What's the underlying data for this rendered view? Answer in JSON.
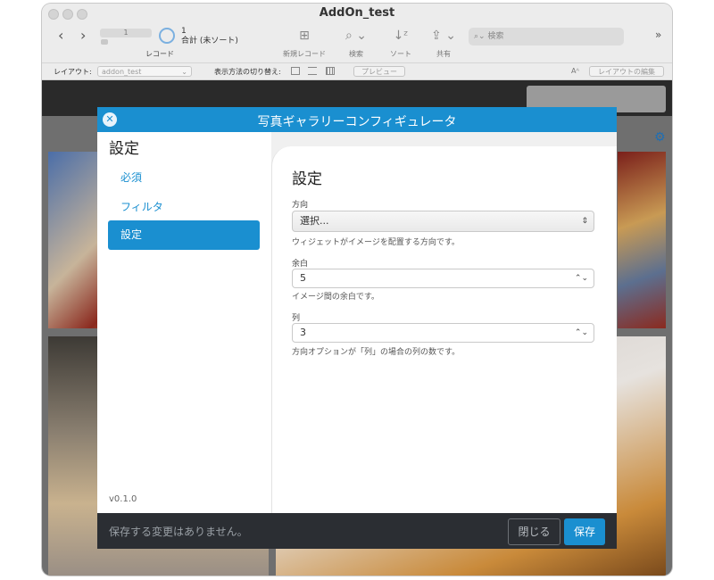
{
  "window": {
    "title": "AddOn_test"
  },
  "toolbar": {
    "record_slider_value": "1",
    "record_label": "レコード",
    "record_count": "1",
    "record_total": "合計 (未ソート)",
    "new_record": "新規レコード",
    "find": "検索",
    "sort": "ソート",
    "share": "共有",
    "search_placeholder": "検索",
    "overflow": "»"
  },
  "layoutbar": {
    "layout_label": "レイアウト:",
    "layout_value": "addon_test",
    "view_as_label": "表示方法の切り替え:",
    "preview": "プレビュー",
    "font_icon": "Aᴬ",
    "edit_layout": "レイアウトの編集"
  },
  "modal": {
    "title": "写真ギャラリーコンフィギュレータ",
    "close_glyph": "✕",
    "sidebar": {
      "title": "設定",
      "items": [
        "必須",
        "フィルタ",
        "設定"
      ],
      "active_index": 2,
      "version": "v0.1.0"
    },
    "main": {
      "title": "設定",
      "fields": [
        {
          "label": "方向",
          "value": "選択...",
          "help": "ウィジェットがイメージを配置する方向です。"
        },
        {
          "label": "余白",
          "value": "5",
          "help": "イメージ間の余白です。"
        },
        {
          "label": "列",
          "value": "3",
          "help": "方向オプションが「列」の場合の列の数です。"
        }
      ]
    },
    "footer": {
      "message": "保存する変更はありません。",
      "close_label": "閉じる",
      "save_label": "保存"
    }
  },
  "colors": {
    "accent": "#1a8fd0",
    "footer_bg": "#2b2e33"
  }
}
